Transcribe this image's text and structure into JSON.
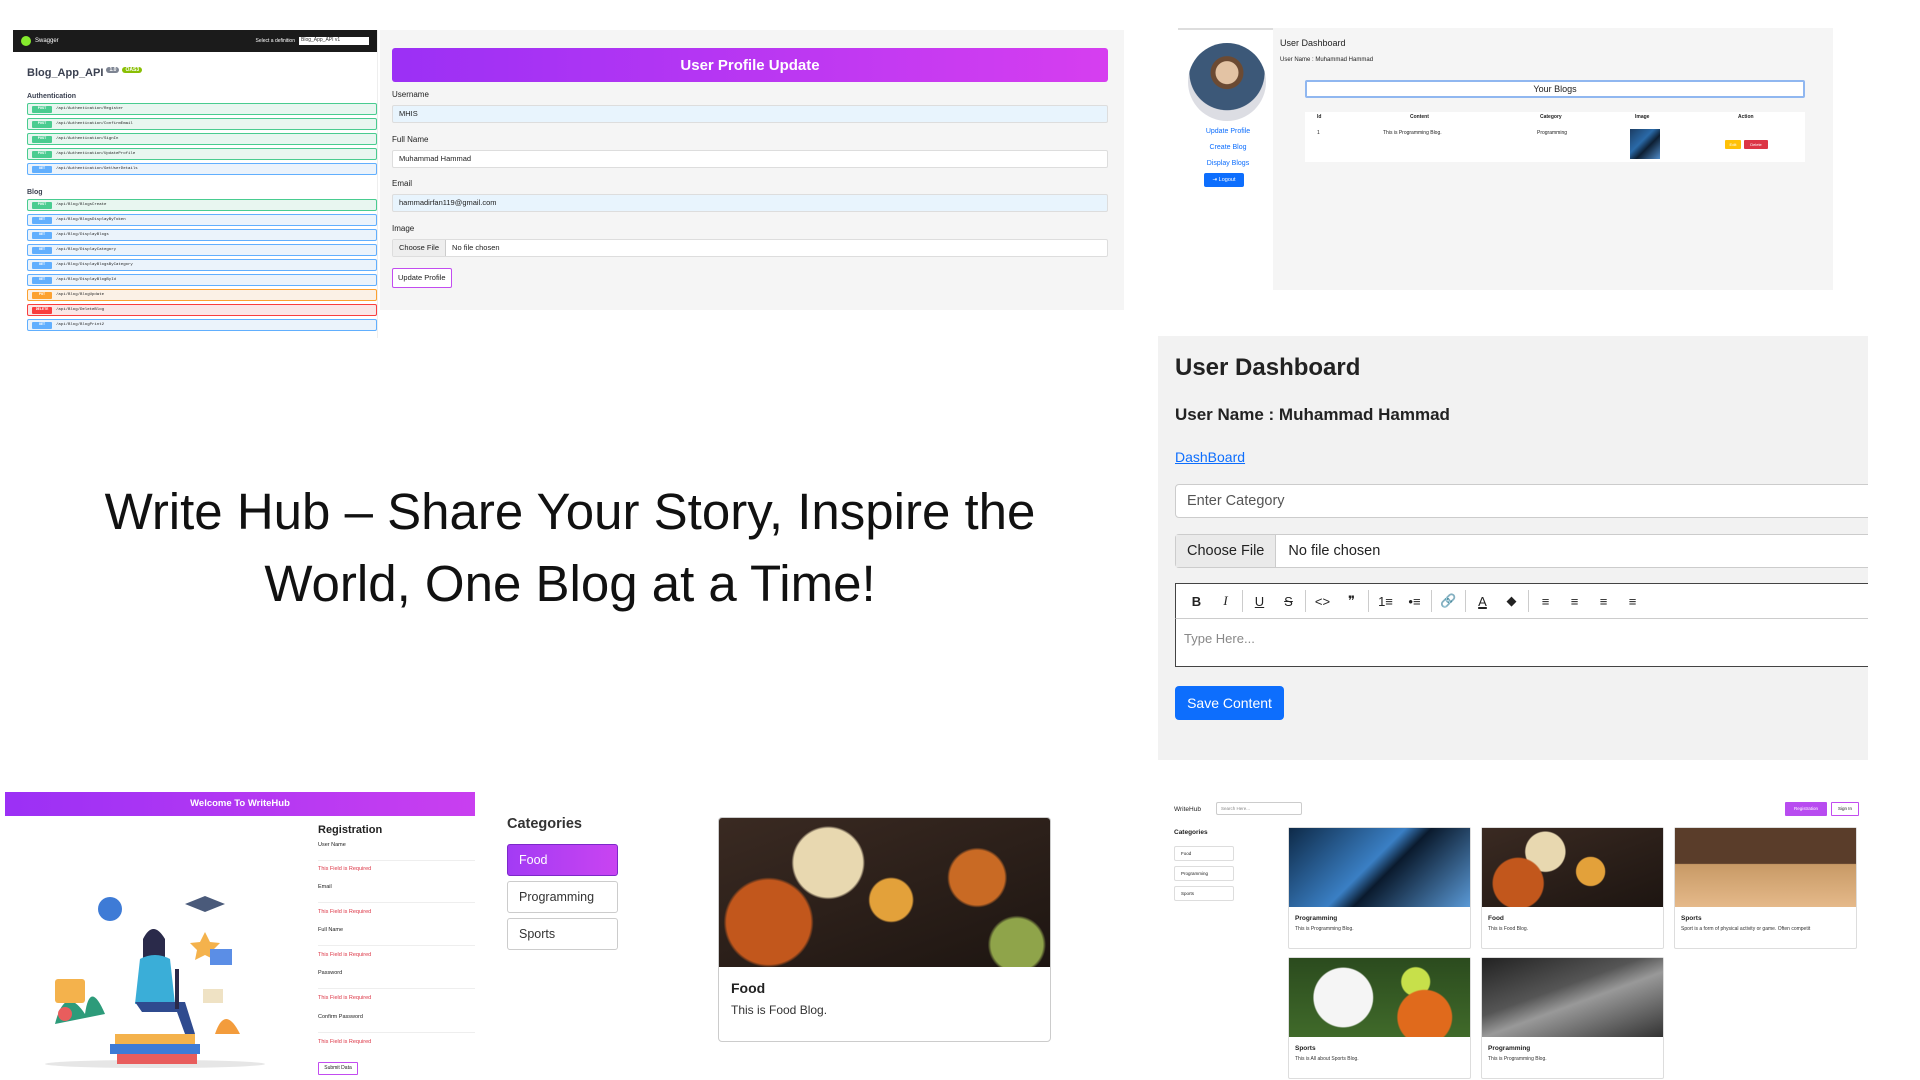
{
  "swagger": {
    "logo_text": "Swagger",
    "select_label": "Select a definition",
    "select_value": "Blog_App_API v1",
    "title": "Blog_App_API",
    "version": "1.0",
    "oas": "OAS3",
    "sections": [
      {
        "name": "Authentication",
        "rows": [
          {
            "method": "POST",
            "path": "/api/Authentication/Register"
          },
          {
            "method": "POST",
            "path": "/api/Authentication/ConfirmEmail"
          },
          {
            "method": "POST",
            "path": "/api/Authentication/SignIn"
          },
          {
            "method": "POST",
            "path": "/api/Authentication/UpdateProfile"
          },
          {
            "method": "GET",
            "path": "/api/Authentication/GetUserDetails"
          }
        ]
      },
      {
        "name": "Blog",
        "rows": [
          {
            "method": "POST",
            "path": "/api/Blog/BlogsCreate"
          },
          {
            "method": "GET",
            "path": "/api/Blog/BlogsDisplayByToken"
          },
          {
            "method": "GET",
            "path": "/api/Blog/DisplayBlogs"
          },
          {
            "method": "GET",
            "path": "/api/Blog/DisplayCategory"
          },
          {
            "method": "GET",
            "path": "/api/Blog/DisplayBlogsByCategory"
          },
          {
            "method": "GET",
            "path": "/api/Blog/DisplayBlogById"
          },
          {
            "method": "PUT",
            "path": "/api/Blog/BlogUpdate"
          },
          {
            "method": "DELETE",
            "path": "/api/Blog/DeleteBlog"
          },
          {
            "method": "GET",
            "path": "/api/Blog/BlogPrint2"
          }
        ]
      }
    ]
  },
  "profile_update": {
    "header": "User Profile Update",
    "username_label": "Username",
    "username_value": "MHIS",
    "fullname_label": "Full Name",
    "fullname_value": "Muhammad Hammad",
    "email_label": "Email",
    "email_value": "hammadirfan119@gmail.com",
    "image_label": "Image",
    "choose_file": "Choose File",
    "no_file": "No file chosen",
    "submit": "Update Profile"
  },
  "dashboard_small": {
    "links": [
      "Update Profile",
      "Create Blog",
      "Display Blogs"
    ],
    "logout": "Logout",
    "title": "User Dashboard",
    "user": "User Name : Muhammad Hammad",
    "your_blogs": "Your Blogs",
    "columns": [
      "Id",
      "Content",
      "Category",
      "Image",
      "Action"
    ],
    "row": {
      "id": "1",
      "content": "This is Programming Blog.",
      "category": "Programming"
    },
    "edit": "Edit",
    "delete": "Delete"
  },
  "tagline": {
    "line1": "Write Hub – Share Your Story, Inspire the",
    "line2": "World, One Blog at a Time!"
  },
  "dashboard_large": {
    "title": "User Dashboard",
    "user": "User Name : Muhammad Hammad",
    "link": "DashBoard",
    "category_placeholder": "Enter Category",
    "choose_file": "Choose File",
    "no_file": "No file chosen",
    "editor_placeholder": "Type Here...",
    "save": "Save Content",
    "toolbar": [
      "B",
      "I",
      "U",
      "S",
      "<>",
      "❞",
      "1≡",
      "•≡",
      "🔗",
      "A",
      "◆",
      "≡",
      "≡",
      "≡",
      "≡"
    ]
  },
  "registration": {
    "header": "Welcome To WriteHub",
    "title": "Registration",
    "fields": [
      "User Name",
      "Email",
      "Full Name",
      "Password",
      "Confirm Password"
    ],
    "error": "This Field is Required",
    "submit": "Submit Data"
  },
  "categories": {
    "title": "Categories",
    "items": [
      "Food",
      "Programming",
      "Sports"
    ]
  },
  "food_card": {
    "title": "Food",
    "desc": "This is Food Blog."
  },
  "home": {
    "brand": "WriteHub",
    "search_placeholder": "Search Here...",
    "register": "Registration",
    "signin": "Sign In",
    "categories_title": "Categories",
    "categories": [
      "Food",
      "Programming",
      "Sports"
    ],
    "cards": [
      {
        "title": "Programming",
        "desc": "This is Programming Blog."
      },
      {
        "title": "Food",
        "desc": "This is Food Blog."
      },
      {
        "title": "Sports",
        "desc": "Sport is a form of physical activity or game. Often competit"
      },
      {
        "title": "Sports",
        "desc": "This is All about Sports Blog."
      },
      {
        "title": "Programming",
        "desc": "This is Programming Blog."
      }
    ]
  }
}
